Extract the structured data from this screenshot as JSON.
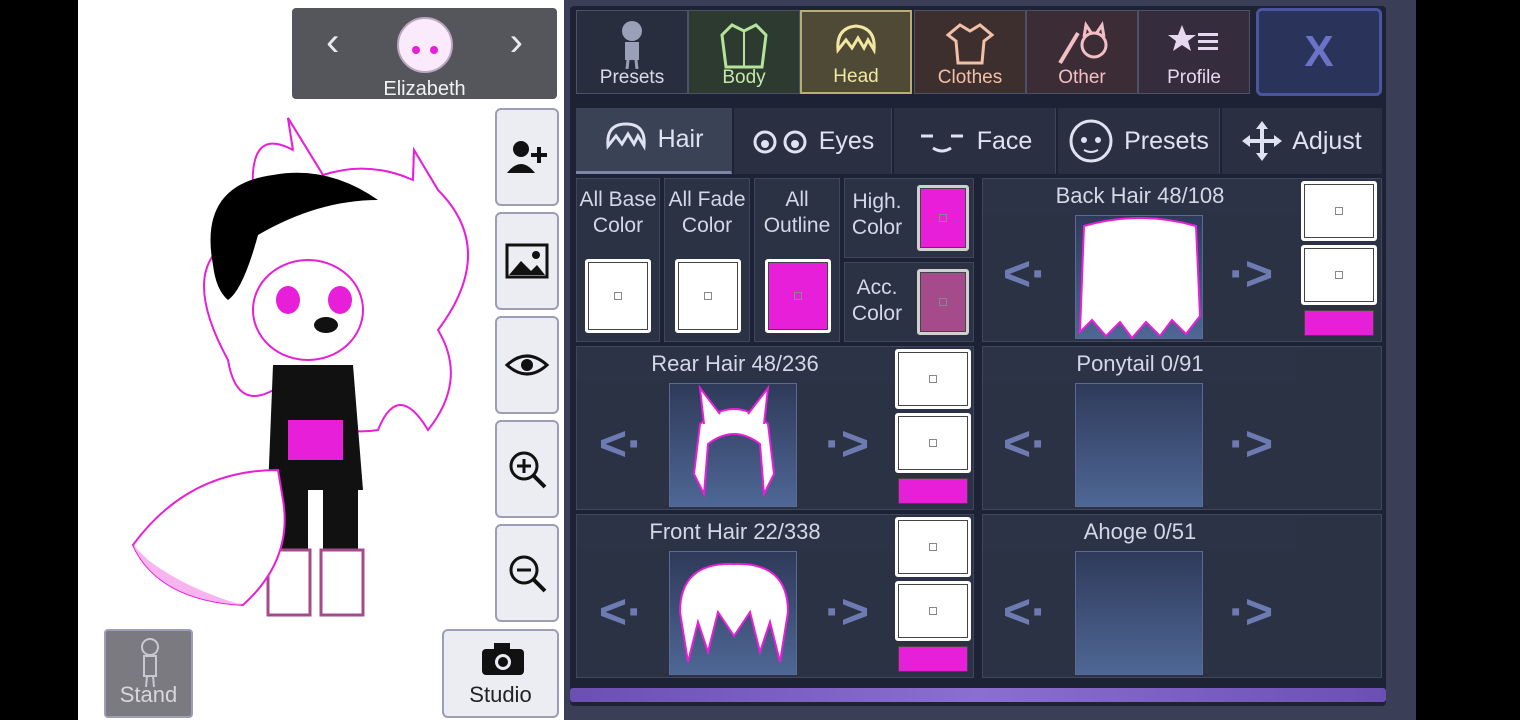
{
  "character": {
    "name": "Elizabeth"
  },
  "left_buttons": {
    "stand_label": "Stand",
    "studio_label": "Studio"
  },
  "top_tabs": [
    {
      "label": "Presets",
      "color": "#d8dbe8",
      "icon": "mannequin-icon"
    },
    {
      "label": "Body",
      "color": "#c5e8a8",
      "icon": "jacket-icon"
    },
    {
      "label": "Head",
      "color": "#f2e6a2",
      "icon": "hair-icon"
    },
    {
      "label": "Clothes",
      "color": "#f2c0a6",
      "icon": "shirt-icon"
    },
    {
      "label": "Other",
      "color": "#f2c0c4",
      "icon": "sword-cat-icon"
    },
    {
      "label": "Profile",
      "color": "#e6d8ef",
      "icon": "star-list-icon"
    }
  ],
  "close_label": "X",
  "sub_tabs": [
    {
      "label": "Hair",
      "icon": "hair-icon"
    },
    {
      "label": "Eyes",
      "icon": "eyes-icon"
    },
    {
      "label": "Face",
      "icon": "face-icon"
    },
    {
      "label": "Presets",
      "icon": "face-preset-icon"
    },
    {
      "label": "Adjust",
      "icon": "move-icon"
    }
  ],
  "color_options": {
    "all_base": "All Base Color",
    "all_fade": "All Fade Color",
    "all_outline": "All Outline",
    "high_color": "High. Color",
    "acc_color": "Acc. Color"
  },
  "colors": {
    "white": "#ffffff",
    "magenta": "#e81fd8",
    "mauve": "#a54a8a",
    "accent": "#6e7bb3"
  },
  "slots": {
    "back_hair": "Back Hair 48/108",
    "rear_hair": "Rear Hair 48/236",
    "ponytail": "Ponytail 0/91",
    "front_hair": "Front Hair 22/338",
    "ahoge": "Ahoge 0/51"
  },
  "nav": {
    "prev": "<·",
    "next": "·>"
  }
}
